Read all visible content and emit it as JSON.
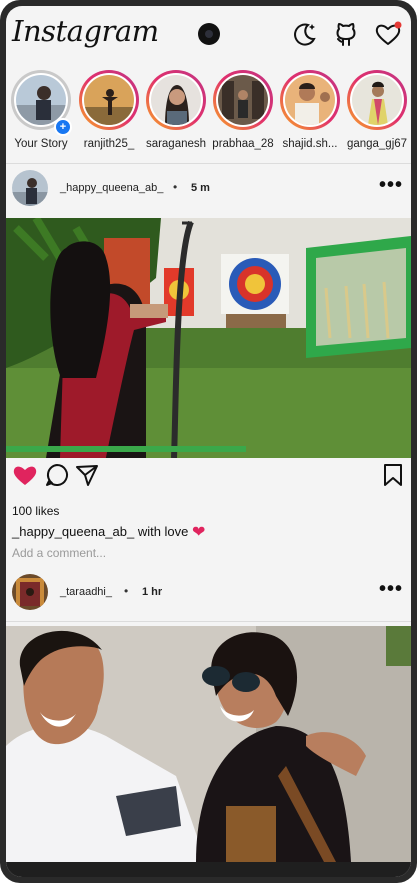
{
  "header": {
    "logo": "Instagram",
    "icons": [
      "moon-icon",
      "github-icon",
      "heart-icon"
    ],
    "notification_dot_color": "#e53935"
  },
  "stories": [
    {
      "name": "Your Story",
      "own": true
    },
    {
      "name": "ranjith25_"
    },
    {
      "name": "saraganesh"
    },
    {
      "name": "prabhaa_28"
    },
    {
      "name": "shajid.sh..."
    },
    {
      "name": "ganga_gj67"
    }
  ],
  "posts": [
    {
      "username": "_happy_queena_ab_",
      "dot": "•",
      "time": "5 m",
      "more": "•••",
      "likes": "100 likes",
      "caption_user": "_happy_queena_ab_",
      "caption_text": "with love",
      "caption_emoji": "❤",
      "comment_placeholder": "Add a comment...",
      "liked": true
    },
    {
      "username": "_taraadhi_",
      "dot": "•",
      "time": "1 hr",
      "more": "•••"
    }
  ],
  "colors": {
    "like_red": "#e0245e",
    "story_ring": "#e1306c",
    "your_story_badge": "#1877f2"
  }
}
